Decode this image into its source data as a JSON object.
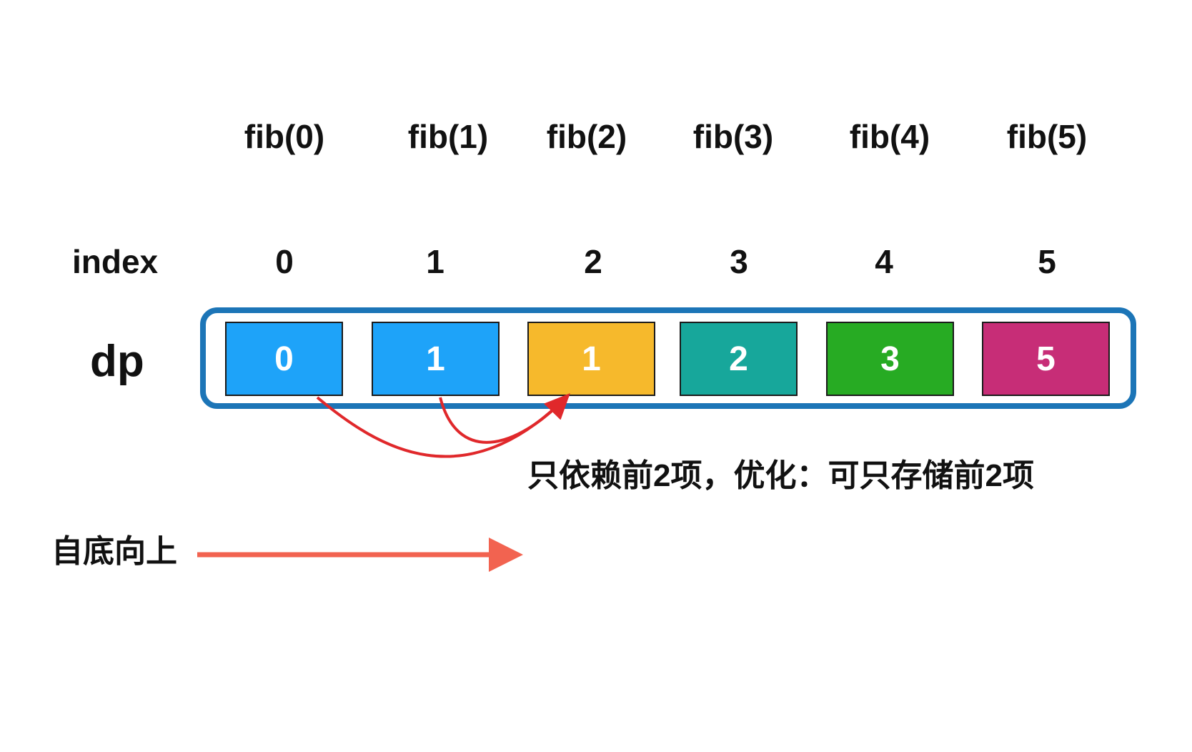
{
  "fib_labels": [
    "fib(0)",
    "fib(1)",
    "fib(2)",
    "fib(3)",
    "fib(4)",
    "fib(5)"
  ],
  "index_row": {
    "label": "index",
    "values": [
      "0",
      "1",
      "2",
      "3",
      "4",
      "5"
    ]
  },
  "dp_row": {
    "label": "dp",
    "cells": [
      {
        "value": "0",
        "color": "#1ea3f9"
      },
      {
        "value": "1",
        "color": "#1ea3f9"
      },
      {
        "value": "1",
        "color": "#f6b92c"
      },
      {
        "value": "2",
        "color": "#17a79b"
      },
      {
        "value": "3",
        "color": "#27ab23"
      },
      {
        "value": "5",
        "color": "#c72d77"
      }
    ],
    "border_color": "#1c75b7"
  },
  "dependency_note": "只依赖前2项，优化：可只存储前2项",
  "direction_label": "自底向上",
  "colors": {
    "dependency_arrows": "#e0282b",
    "direction_arrow": "#f26350",
    "text": "#111111"
  }
}
